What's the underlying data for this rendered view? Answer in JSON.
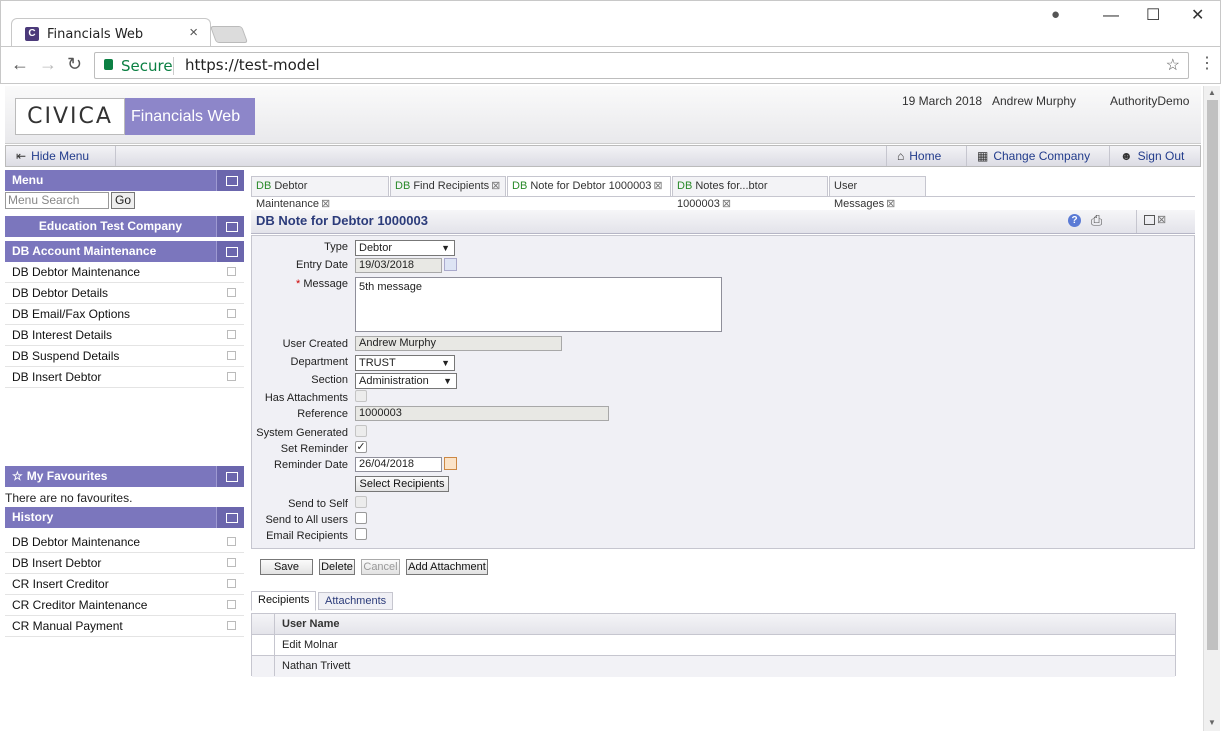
{
  "browser": {
    "tab_title": "Financials Web",
    "favicon_letter": "C",
    "secure_label": "Secure",
    "url": "https://test-model"
  },
  "header": {
    "logo": "CIVICA",
    "product": "Financials Web",
    "date": "19 March 2018",
    "user": "Andrew Murphy",
    "authority": "AuthorityDemo"
  },
  "navbar": {
    "hide_menu": "Hide Menu",
    "home": "Home",
    "change_company": "Change Company",
    "sign_out": "Sign Out"
  },
  "sidebar": {
    "menu_title": "Menu",
    "search_placeholder": "Menu Search",
    "go": "Go",
    "company": "Education Test Company",
    "section": "DB Account Maintenance",
    "items": [
      {
        "label": "DB Debtor Maintenance"
      },
      {
        "label": "DB Debtor Details"
      },
      {
        "label": "DB Email/Fax Options"
      },
      {
        "label": "DB Interest Details"
      },
      {
        "label": "DB Suspend Details"
      },
      {
        "label": "DB Insert Debtor"
      }
    ],
    "favourites_title": "My Favourites",
    "favourites_empty": "There are no favourites.",
    "history_title": "History",
    "history": [
      {
        "label": "DB Debtor Maintenance"
      },
      {
        "label": "DB Insert Debtor"
      },
      {
        "label": "CR Insert Creditor"
      },
      {
        "label": "CR Creditor Maintenance"
      },
      {
        "label": "CR Manual Payment"
      }
    ]
  },
  "tabs": [
    {
      "prefix": "DB",
      "label": " Debtor Maintenance"
    },
    {
      "prefix": "DB",
      "label": " Find Recipients"
    },
    {
      "prefix": "DB",
      "label": " Note for Debtor 1000003"
    },
    {
      "prefix": "DB",
      "label": " Notes for...btor 1000003"
    },
    {
      "prefix": "",
      "label": "User Messages"
    }
  ],
  "page_title": "DB Note for Debtor 1000003",
  "form": {
    "type_label": "Type",
    "type_value": "Debtor",
    "entry_date_label": "Entry Date",
    "entry_date": "19/03/2018",
    "message_required": "*",
    "message_label": "Message",
    "message": "5th message",
    "user_created_label": "User Created",
    "user_created": "Andrew Murphy",
    "department_label": "Department",
    "department": "TRUST",
    "section_label": "Section",
    "section": "Administration",
    "has_attachments_label": "Has Attachments",
    "reference_label": "Reference",
    "reference": "1000003",
    "system_generated_label": "System Generated",
    "set_reminder_label": "Set Reminder",
    "reminder_date_label": "Reminder Date",
    "reminder_date": "26/04/2018",
    "select_recipients": "Select Recipients",
    "send_to_self_label": "Send to Self",
    "send_to_all_label": "Send to All users",
    "email_recipients_label": "Email Recipients"
  },
  "actions": {
    "save": "Save",
    "delete": "Delete",
    "cancel": "Cancel",
    "add_attachment": "Add Attachment"
  },
  "subtabs": {
    "recipients": "Recipients",
    "attachments": "Attachments"
  },
  "grid": {
    "header": "User Name",
    "rows": [
      {
        "name": "Edit Molnar"
      },
      {
        "name": "Nathan Trivett"
      }
    ]
  }
}
